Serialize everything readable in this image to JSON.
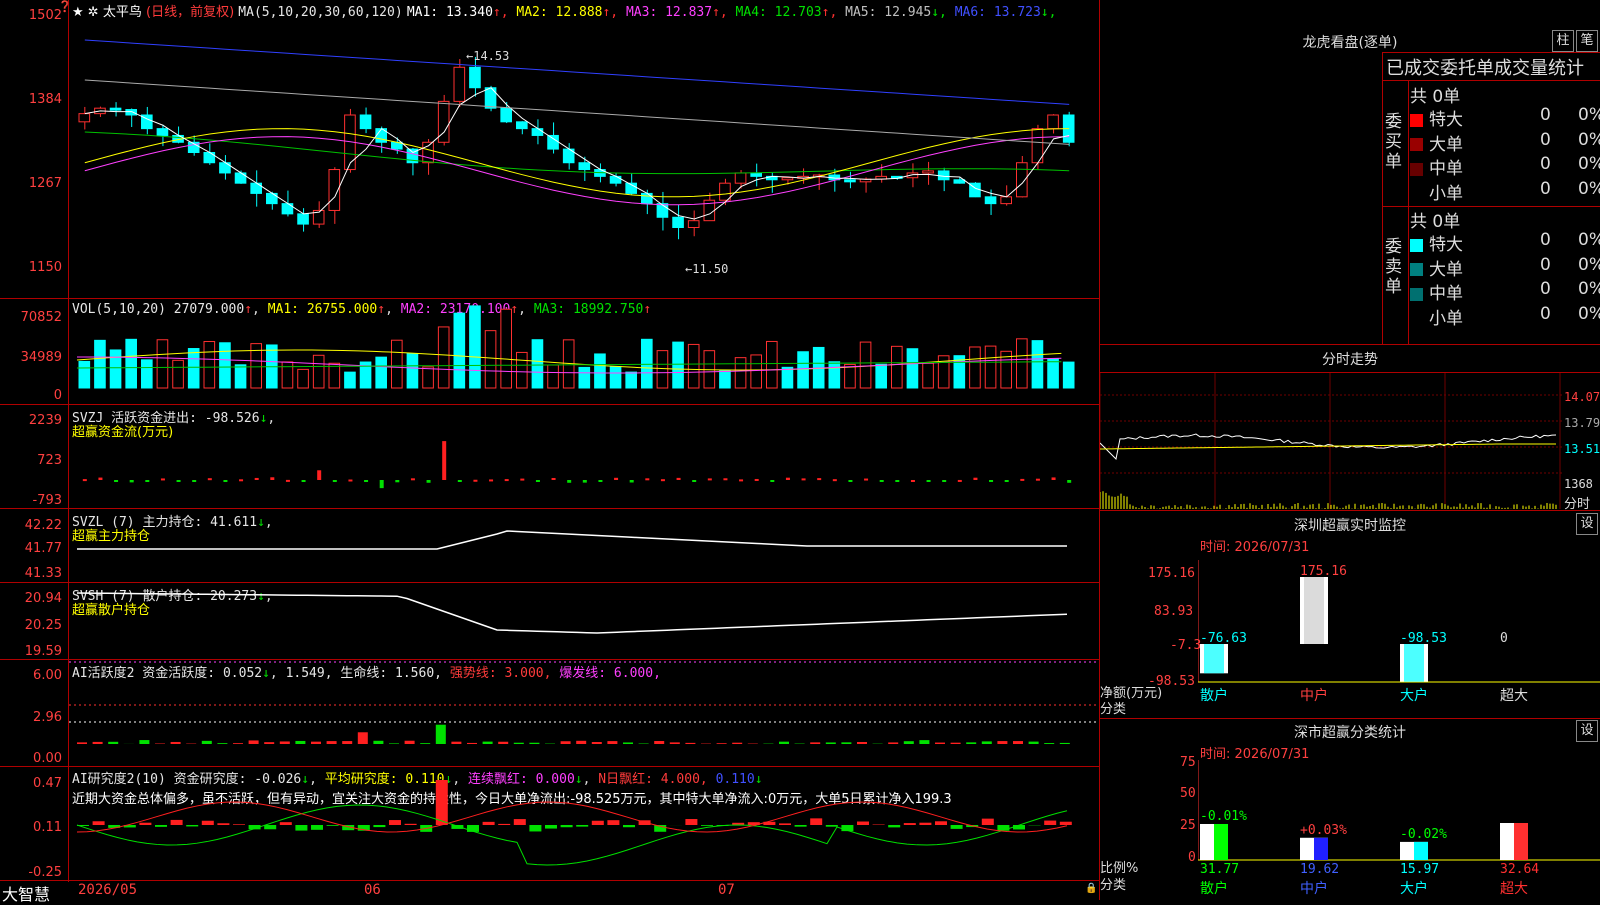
{
  "header": {
    "stock_name": "太平鸟",
    "period": "(日线，前复权)",
    "ma_label": "MA(5,10,20,30,60,120)",
    "ma": [
      {
        "label": "MA1: 13.340",
        "arrow": "↑",
        "color": "#ffffff"
      },
      {
        "label": "MA2: 12.888",
        "arrow": "↑",
        "color": "#ffff00"
      },
      {
        "label": "MA3: 12.837",
        "arrow": "↑",
        "color": "#ff40ff"
      },
      {
        "label": "MA4: 12.703",
        "arrow": "↑",
        "color": "#00e000"
      },
      {
        "label": "MA5: 12.945",
        "arrow": "↓",
        "color": "#c0c0c0"
      },
      {
        "label": "MA6: 13.723",
        "arrow": "↓",
        "color": "#4050ff"
      }
    ]
  },
  "price_axis": [
    "1502",
    "1384",
    "1267",
    "1150"
  ],
  "price_annotations": {
    "high": "14.53",
    "low": "11.50"
  },
  "vol": {
    "label": "VOL(5,10,20)",
    "value": "27079.000",
    "ma1": "MA1: 26755.000",
    "ma2": "MA2: 23170.100",
    "ma3": "MA3: 18992.750",
    "axis": [
      "70852",
      "34989",
      "0"
    ]
  },
  "svzj": {
    "label": "SVZJ  活跃资金进出: -98.526",
    "subtitle": "超赢资金流(万元)",
    "axis": [
      "2239",
      "723",
      "-793"
    ]
  },
  "svzl": {
    "label": "SVZL (7) 主力持仓: 41.611",
    "subtitle": "超赢主力持仓",
    "axis": [
      "42.22",
      "41.77",
      "41.33"
    ]
  },
  "svsh": {
    "label": "SVSH (7) 散户持仓: 20.273",
    "subtitle": "超赢散户持仓",
    "axis": [
      "20.94",
      "20.25",
      "19.59"
    ]
  },
  "ai_active": {
    "label": "AI活跃度2 资金活跃度: 0.052",
    "v2": "1.549,",
    "v3": "生命线: 1.560,",
    "v4": "强势线: 3.000,",
    "v5": "爆发线: 6.000,",
    "axis": [
      "6.00",
      "2.96",
      "0.00"
    ]
  },
  "ai_research": {
    "label": "AI研究度2(10) 资金研究度: -0.026",
    "v2": "平均研究度: 0.110",
    "v3": "连续飘红: 0.000",
    "v4": "N日飘红: 4.000,",
    "v5": "0.110",
    "text": "近期大资金总体偏多，虽不活跃，但有异动，宜关注大资金的持续性，今日大单净流出:-98.525万元，其中特大单净流入:0万元，大单5日累计净入199.3",
    "axis": [
      "0.47",
      "0.11",
      "-0.25"
    ]
  },
  "date_axis": {
    "brand": "大智慧",
    "d1": "2026/05",
    "d2": "06",
    "d3": "07"
  },
  "dragon": {
    "title": "龙虎看盘(逐单)",
    "btn1": "柱",
    "btn2": "笔",
    "subtitle": "已成交委托单成交量统计",
    "buy_side": "委买单",
    "sell_side": "委卖单",
    "buy_total": "共 0单",
    "sell_total": "共 0单",
    "buy_rows": [
      {
        "name": "特大",
        "qty": "0",
        "pct": "0%",
        "color": "#ff0000"
      },
      {
        "name": "大单",
        "qty": "0",
        "pct": "0%",
        "color": "#990000"
      },
      {
        "name": "中单",
        "qty": "0",
        "pct": "0%",
        "color": "#660000"
      },
      {
        "name": "小单",
        "qty": "0",
        "pct": "0%",
        "color": "#000000"
      }
    ],
    "sell_rows": [
      {
        "name": "特大",
        "qty": "0",
        "pct": "0%",
        "color": "#00ffff"
      },
      {
        "name": "大单",
        "qty": "0",
        "pct": "0%",
        "color": "#008080"
      },
      {
        "name": "中单",
        "qty": "0",
        "pct": "0%",
        "color": "#007070"
      },
      {
        "name": "小单",
        "qty": "0",
        "pct": "0%",
        "color": "#000000"
      }
    ]
  },
  "intraday": {
    "title": "分时走势",
    "axis": [
      "14.07",
      "13.79",
      "13.51",
      "1368"
    ],
    "label": "分时"
  },
  "sz_monitor": {
    "title": "深圳超赢实时监控",
    "btn": "设",
    "time": "时间: 2026/07/31",
    "axis": [
      "175.16",
      "83.93",
      "-7.3",
      "-98.53"
    ],
    "side_label": "净额(万元)",
    "cat_label": "分类",
    "categories": [
      "散户",
      "中户",
      "大户",
      "超大"
    ],
    "values": [
      -76.63,
      175.16,
      -98.53,
      0
    ],
    "value_labels": [
      "-76.63",
      "175.16",
      "-98.53",
      "0"
    ]
  },
  "sz_stats": {
    "title": "深市超赢分类统计",
    "btn": "设",
    "time": "时间: 2026/07/31",
    "axis": [
      "75",
      "50",
      "25",
      "0"
    ],
    "side_label": "比例%",
    "cat_label": "分类",
    "categories": [
      "散户",
      "中户",
      "大户",
      "超大"
    ],
    "values": [
      31.77,
      19.62,
      15.97,
      32.64
    ],
    "value_labels": [
      "31.77",
      "19.62",
      "15.97",
      "32.64"
    ],
    "delta_labels": [
      "-0.01%",
      "+0.03%",
      "-0.02%",
      ""
    ],
    "colors": [
      "#00ff00",
      "#2020ff",
      "#00ffff",
      "#ff3030"
    ]
  }
}
